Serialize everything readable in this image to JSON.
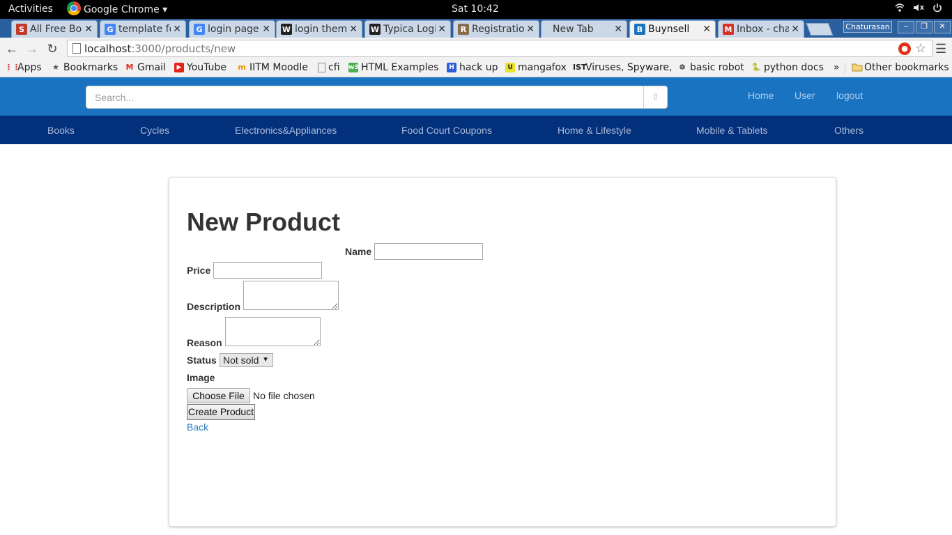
{
  "desktop": {
    "activities_label": "Activities",
    "app_menu_label": "Google Chrome ▾",
    "clock": "Sat 10:42",
    "tray": [
      "wifi-icon",
      "volume-icon",
      "power-icon"
    ]
  },
  "browser": {
    "tabs": [
      {
        "title": "All Free Bo",
        "favicon": "S",
        "color": "#c0392b",
        "active": false
      },
      {
        "title": "template fo",
        "favicon": "G",
        "color": "#4285f4",
        "active": false
      },
      {
        "title": "login page",
        "favicon": "G",
        "color": "#4285f4",
        "active": false
      },
      {
        "title": "login theme",
        "favicon": "W",
        "color": "#222222",
        "active": false
      },
      {
        "title": "Typica Logi",
        "favicon": "W",
        "color": "#222222",
        "active": false
      },
      {
        "title": "Registratio",
        "favicon": "R",
        "color": "#8a6d4a",
        "active": false
      },
      {
        "title": "New Tab",
        "favicon": "",
        "color": "",
        "active": false
      },
      {
        "title": "Buynsell",
        "favicon": "B",
        "color": "#1a73c1",
        "active": true
      },
      {
        "title": "Inbox - cha",
        "favicon": "M",
        "color": "#d93025",
        "active": false
      }
    ],
    "profile_name": "Chaturasan",
    "url_host": "localhost",
    "url_path": ":3000/products/new",
    "bookmarks": [
      {
        "label": "Apps",
        "icon": "apps-grid-icon"
      },
      {
        "label": "Bookmarks",
        "icon": "star-icon"
      },
      {
        "label": "Gmail",
        "icon": "gmail-icon"
      },
      {
        "label": "YouTube",
        "icon": "youtube-icon"
      },
      {
        "label": "IITM Moodle",
        "icon": "moodle-icon"
      },
      {
        "label": "cfi",
        "icon": "page-icon"
      },
      {
        "label": "HTML Examples",
        "icon": "w3-icon"
      },
      {
        "label": "hack up",
        "icon": "hack-icon"
      },
      {
        "label": "mangafox",
        "icon": "mangafox-icon"
      },
      {
        "label": "Viruses, Spyware,",
        "icon": "ist-icon"
      },
      {
        "label": "basic robot",
        "icon": "robot-icon"
      },
      {
        "label": "python docs",
        "icon": "python-icon"
      }
    ],
    "bookmarks_overflow": "»",
    "other_bookmarks": "Other bookmarks"
  },
  "app": {
    "search_placeholder": "Search...",
    "search_button_icon": "⇧",
    "header_links": [
      "Home",
      "User",
      "logout"
    ],
    "categories": [
      "Books",
      "Cycles",
      "Electronics&Appliances",
      "Food Court Coupons",
      "Home & Lifestyle",
      "Mobile & Tablets",
      "Others"
    ]
  },
  "form": {
    "title": "New Product",
    "name_label": "Name",
    "price_label": "Price",
    "description_label": "Description",
    "reason_label": "Reason",
    "status_label": "Status",
    "status_value": "Not sold",
    "image_label": "Image",
    "choose_file_label": "Choose File",
    "no_file_text": "No file chosen",
    "submit_label": "Create Product",
    "back_label": "Back"
  }
}
